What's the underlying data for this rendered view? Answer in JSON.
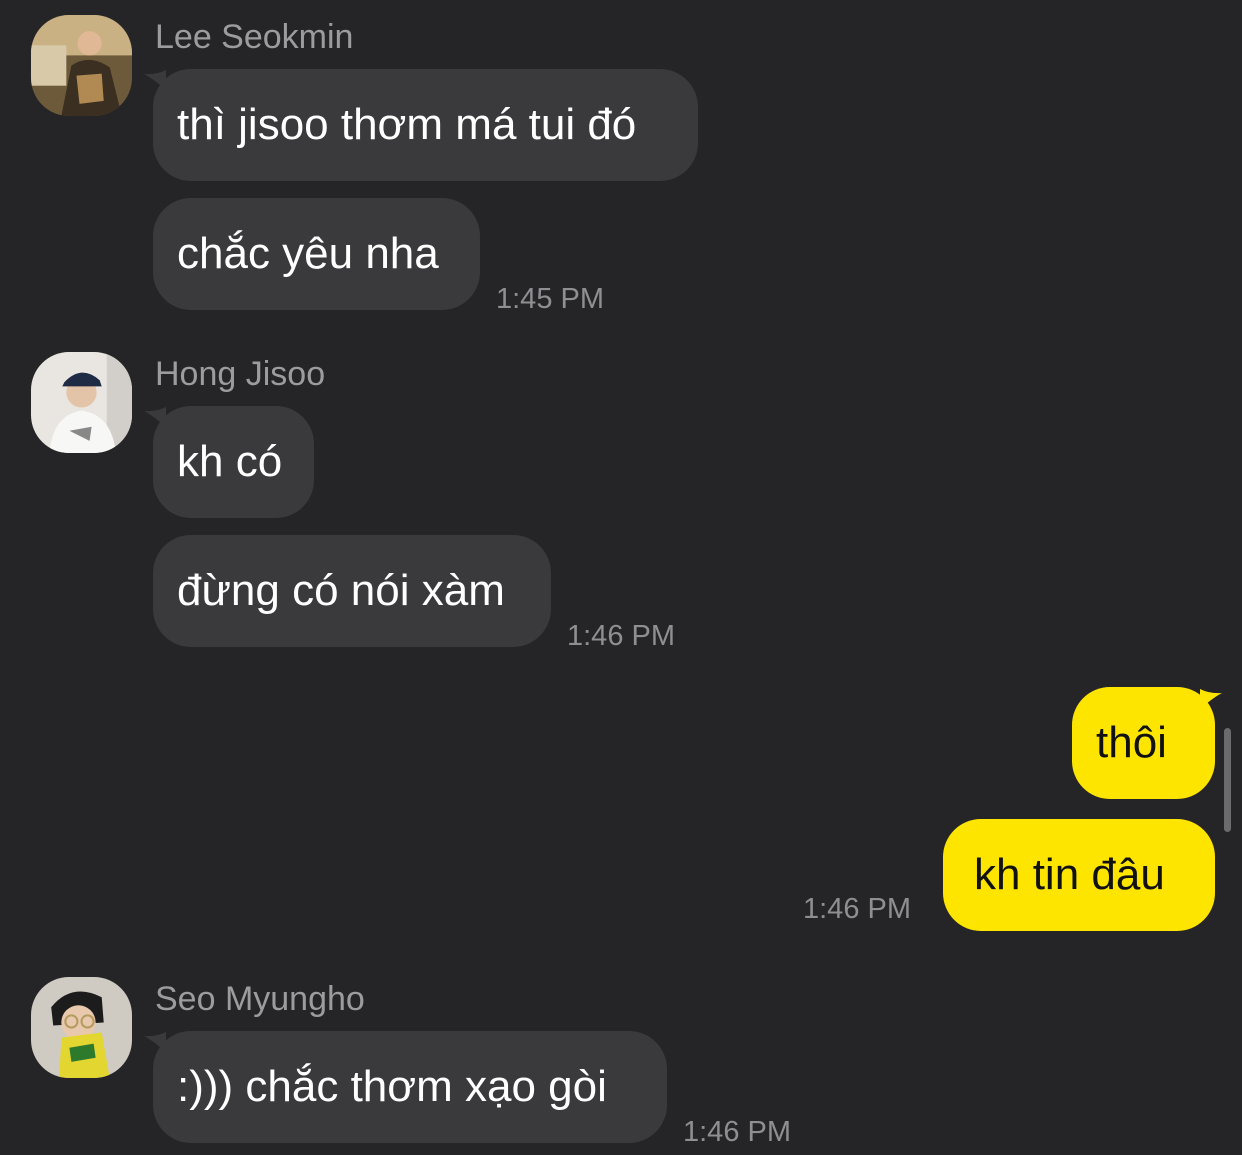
{
  "colors": {
    "background": "#252527",
    "incoming_bubble": "#3a3a3c",
    "outgoing_bubble": "#fee500",
    "sender_name": "#9c9ca0",
    "timestamp": "#8e8e93"
  },
  "messages": [
    {
      "sender": "Lee Seokmin",
      "avatar": "profile-photo",
      "bubbles": [
        "thì jisoo thơm má tui đó",
        "chắc yêu nha"
      ],
      "time": "1:45 PM"
    },
    {
      "sender": "Hong Jisoo",
      "avatar": "profile-photo",
      "bubbles": [
        "kh có",
        "đừng có nói xàm"
      ],
      "time": "1:46 PM"
    },
    {
      "sender": "me",
      "bubbles": [
        "thôi",
        "kh tin đâu"
      ],
      "time": "1:46 PM"
    },
    {
      "sender": "Seo Myungho",
      "avatar": "profile-photo",
      "bubbles": [
        ":))) chắc thơm xạo gòi"
      ],
      "time": "1:46 PM"
    }
  ]
}
